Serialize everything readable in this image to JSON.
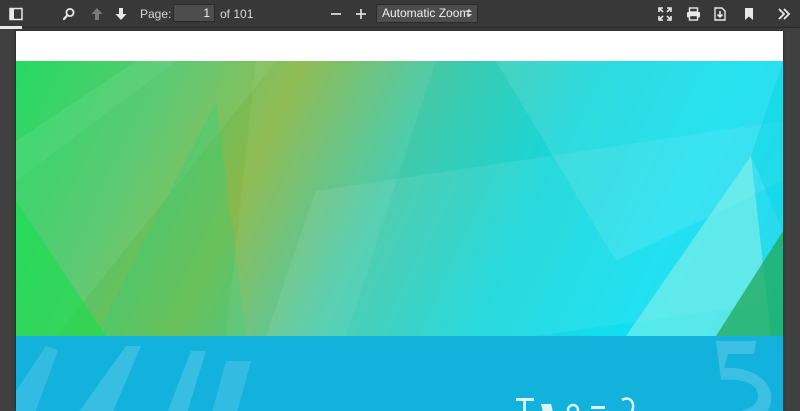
{
  "toolbar": {
    "page_label": "Page:",
    "page_number": "1",
    "page_count_text": "of 101",
    "zoom_value": "Automatic Zoom"
  },
  "colors": {
    "toolbar_bg": "#383838",
    "viewer_bg": "#404040",
    "cover_blue": "#13b2dc",
    "cover_cyan": "#10dff0",
    "cover_green": "#1bd85c"
  }
}
